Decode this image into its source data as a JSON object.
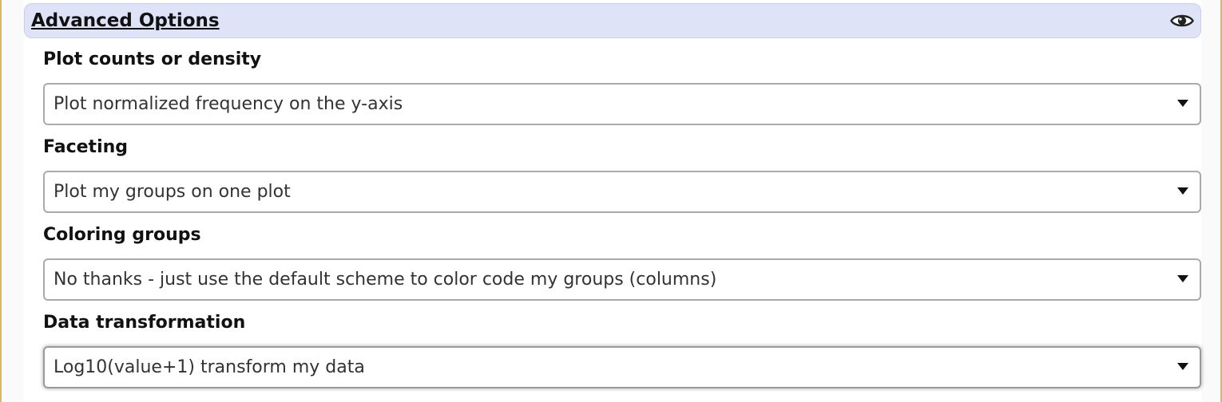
{
  "panel": {
    "title": "Advanced Options",
    "toggle_icon": "eye-icon"
  },
  "fields": [
    {
      "label": "Plot counts or density",
      "selected": "Plot normalized frequency on the y-axis"
    },
    {
      "label": "Faceting",
      "selected": "Plot my groups on one plot"
    },
    {
      "label": "Coloring groups",
      "selected": "No thanks - just use the default scheme to color code my groups (columns)"
    },
    {
      "label": "Data transformation",
      "selected": "Log10(value+1) transform my data"
    }
  ],
  "colors": {
    "header_bg": "#dee3f7",
    "frame_border": "#d9b66c",
    "select_border": "#aaaaaa"
  }
}
